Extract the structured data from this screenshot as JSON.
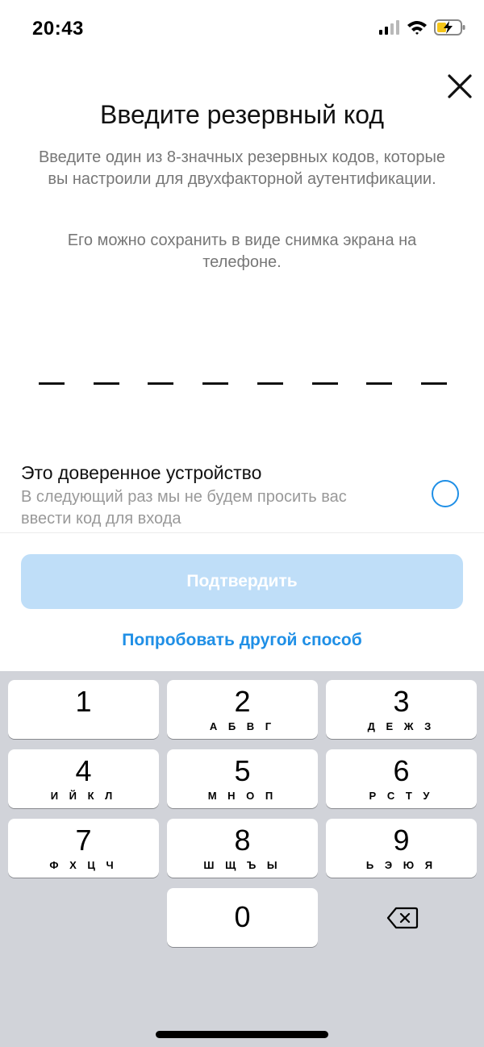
{
  "status_bar": {
    "time": "20:43",
    "icons": [
      "signal-icon",
      "wifi-icon",
      "battery-charging-icon"
    ]
  },
  "header": {
    "close_icon": "close-icon",
    "title": "Введите резервный код"
  },
  "description": {
    "line1": "Введите один из 8-значных резервных кодов, которые вы настроили для двухфакторной аутентификации.",
    "line2": "Его можно сохранить в виде снимка экрана на телефоне."
  },
  "code_input": {
    "length": 8,
    "value": ""
  },
  "trusted_device": {
    "title": "Это доверенное устройство",
    "description": "В следующий раз мы не будем просить вас ввести код для входа",
    "checked": false
  },
  "actions": {
    "confirm_label": "Подтвердить",
    "confirm_enabled": false,
    "alternate_label": "Попробовать другой способ"
  },
  "keypad": {
    "keys": [
      {
        "digit": "1",
        "letters": ""
      },
      {
        "digit": "2",
        "letters": "А Б В Г"
      },
      {
        "digit": "3",
        "letters": "Д Е Ж З"
      },
      {
        "digit": "4",
        "letters": "И Й К Л"
      },
      {
        "digit": "5",
        "letters": "М Н О П"
      },
      {
        "digit": "6",
        "letters": "Р С Т У"
      },
      {
        "digit": "7",
        "letters": "Ф Х Ц Ч"
      },
      {
        "digit": "8",
        "letters": "Ш Щ Ъ Ы"
      },
      {
        "digit": "9",
        "letters": "Ь Э Ю Я"
      },
      {
        "digit": "0",
        "letters": ""
      }
    ],
    "delete_icon": "backspace-icon"
  },
  "colors": {
    "accent": "#1f8fe6",
    "button_disabled": "#bfdef8",
    "keypad_background": "#d1d3d9",
    "secondary_text": "#777777"
  }
}
